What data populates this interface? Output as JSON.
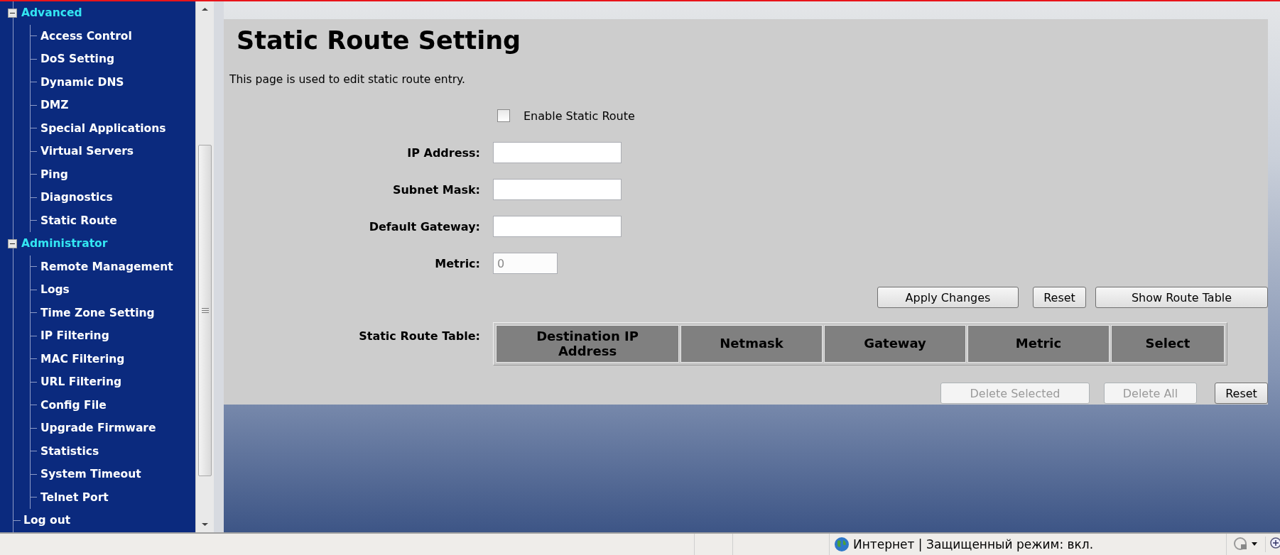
{
  "sidebar": {
    "tree": [
      {
        "label": "Advanced",
        "expanded": true,
        "children": [
          {
            "label": "Access Control"
          },
          {
            "label": "DoS Setting"
          },
          {
            "label": "Dynamic DNS"
          },
          {
            "label": "DMZ"
          },
          {
            "label": "Special Applications"
          },
          {
            "label": "Virtual Servers"
          },
          {
            "label": "Ping"
          },
          {
            "label": "Diagnostics"
          },
          {
            "label": "Static Route"
          }
        ]
      },
      {
        "label": "Administrator",
        "expanded": true,
        "children": [
          {
            "label": "Remote Management"
          },
          {
            "label": "Logs"
          },
          {
            "label": "Time Zone Setting"
          },
          {
            "label": "IP Filtering"
          },
          {
            "label": "MAC Filtering"
          },
          {
            "label": "URL Filtering"
          },
          {
            "label": "Config File"
          },
          {
            "label": "Upgrade Firmware"
          },
          {
            "label": "Statistics"
          },
          {
            "label": "System Timeout"
          },
          {
            "label": "Telnet Port"
          }
        ]
      },
      {
        "label": "Log out"
      }
    ]
  },
  "page": {
    "title": "Static Route Setting",
    "description": "This page is used to edit static route entry.",
    "enable": {
      "label": "Enable Static Route",
      "checked": false
    },
    "fields": [
      {
        "label": "IP Address:",
        "kind": "address"
      },
      {
        "label": "Subnet Mask:",
        "kind": "address"
      },
      {
        "label": "Default Gateway:",
        "kind": "address"
      },
      {
        "label": "Metric:",
        "kind": "number",
        "value": "0",
        "disabled": true
      }
    ],
    "actions": [
      {
        "label": "Apply Changes",
        "disabled": false
      },
      {
        "label": "Reset",
        "disabled": false
      },
      {
        "label": "Show Route Table",
        "disabled": false
      }
    ],
    "table": {
      "label": "Static Route Table:",
      "columns": [
        "Destination IP Address",
        "Netmask",
        "Gateway",
        "Metric",
        "Select"
      ]
    },
    "table_actions": [
      {
        "label": "Delete Selected",
        "disabled": true
      },
      {
        "label": "Delete All",
        "disabled": true
      },
      {
        "label": "Reset",
        "disabled": false
      }
    ]
  },
  "status_bar": {
    "zone": "Интернет | Защищенный режим: вкл."
  }
}
